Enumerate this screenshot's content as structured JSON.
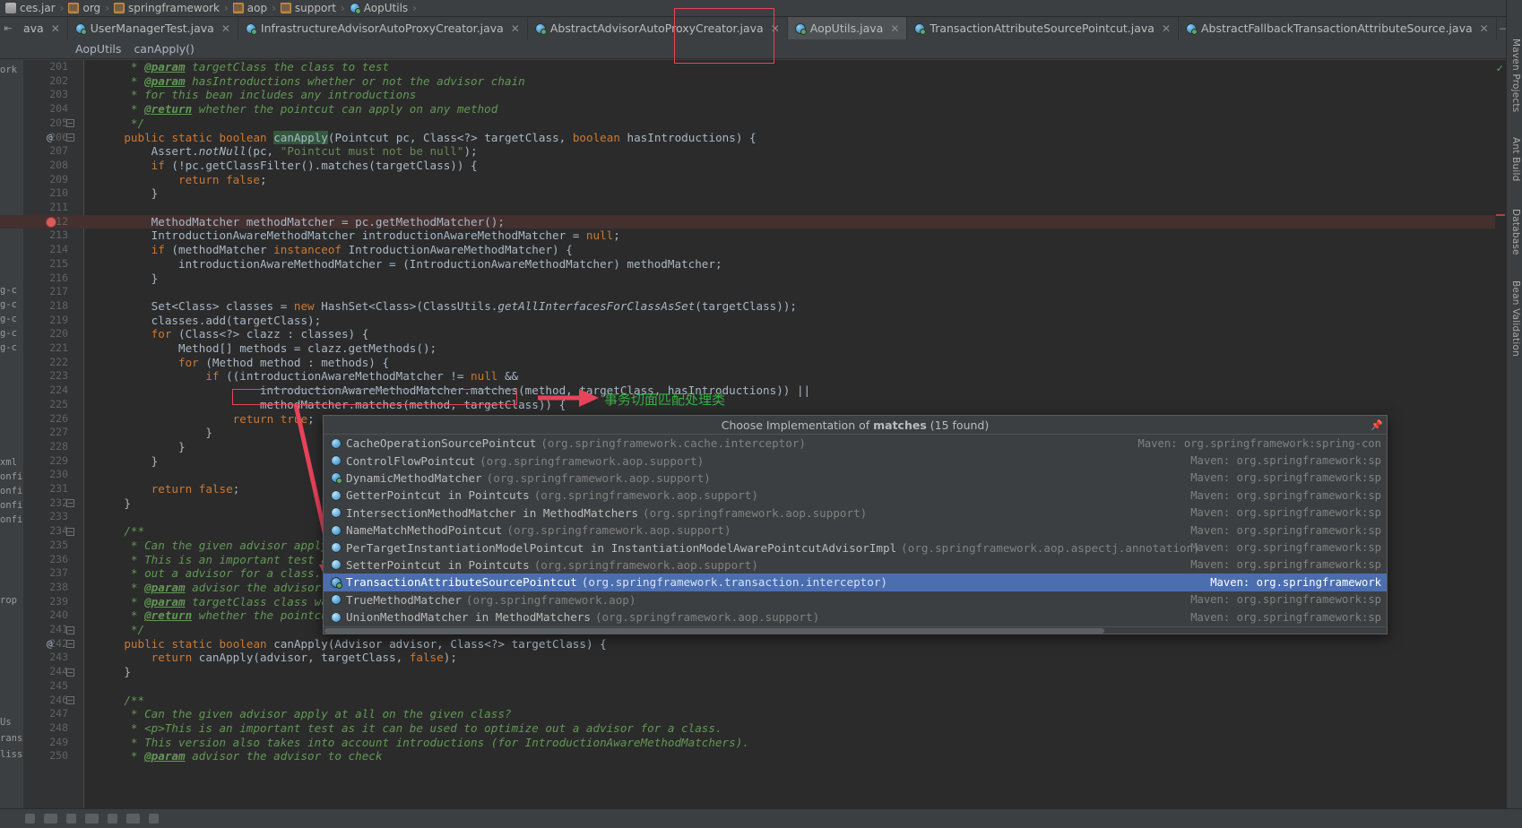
{
  "breadcrumb": [
    {
      "label": "ces.jar",
      "icon": "jar-icon"
    },
    {
      "label": "org",
      "icon": "folder-icon"
    },
    {
      "label": "springframework",
      "icon": "folder-icon"
    },
    {
      "label": "aop",
      "icon": "folder-icon"
    },
    {
      "label": "support",
      "icon": "folder-icon"
    },
    {
      "label": "AopUtils",
      "icon": "class-icon"
    }
  ],
  "tabs": [
    {
      "label": "ava",
      "icon": "class-icon",
      "active": false,
      "truncated": true
    },
    {
      "label": "UserManagerTest.java",
      "icon": "test-class-icon",
      "active": false
    },
    {
      "label": "InfrastructureAdvisorAutoProxyCreator.java",
      "icon": "class-icon",
      "active": false
    },
    {
      "label": "AbstractAdvisorAutoProxyCreator.java",
      "icon": "abstract-class-icon",
      "active": false
    },
    {
      "label": "AopUtils.java",
      "icon": "class-icon",
      "active": true
    },
    {
      "label": "TransactionAttributeSourcePointcut.java",
      "icon": "class-icon",
      "active": false
    },
    {
      "label": "AbstractFallbackTransactionAttributeSource.java",
      "icon": "abstract-class-icon",
      "active": false
    }
  ],
  "location_bar": {
    "class_name": "AopUtils",
    "method_name": "canApply()"
  },
  "annotation": {
    "chinese_note": "事务切面匹配处理类",
    "note_color": "#35b045",
    "box_color": "#e8435a",
    "boxed_code": "methodMatcher.matches(method, targetClass)"
  },
  "editor": {
    "first_line": 201,
    "breakpoint_line": 212,
    "lines": [
      {
        "n": 201,
        "text": "     * @param targetClass the class to test",
        "type": "comment",
        "clipped": true
      },
      {
        "n": 202,
        "text": "     * @param hasIntroductions whether or not the advisor chain",
        "type": "comment"
      },
      {
        "n": 203,
        "text": "     * for this bean includes any introductions",
        "type": "comment"
      },
      {
        "n": 204,
        "text": "     * @return whether the pointcut can apply on any method",
        "type": "comment"
      },
      {
        "n": 205,
        "text": "     */",
        "type": "comment"
      },
      {
        "n": 206,
        "text": "    public static boolean canApply(Pointcut pc, Class<?> targetClass, boolean hasIntroductions) {",
        "type": "code"
      },
      {
        "n": 207,
        "text": "        Assert.notNull(pc, \"Pointcut must not be null\");",
        "type": "code"
      },
      {
        "n": 208,
        "text": "        if (!pc.getClassFilter().matches(targetClass)) {",
        "type": "code"
      },
      {
        "n": 209,
        "text": "            return false;",
        "type": "code"
      },
      {
        "n": 210,
        "text": "        }",
        "type": "code"
      },
      {
        "n": 211,
        "text": "",
        "type": "code"
      },
      {
        "n": 212,
        "text": "        MethodMatcher methodMatcher = pc.getMethodMatcher();",
        "type": "code"
      },
      {
        "n": 213,
        "text": "        IntroductionAwareMethodMatcher introductionAwareMethodMatcher = null;",
        "type": "code"
      },
      {
        "n": 214,
        "text": "        if (methodMatcher instanceof IntroductionAwareMethodMatcher) {",
        "type": "code"
      },
      {
        "n": 215,
        "text": "            introductionAwareMethodMatcher = (IntroductionAwareMethodMatcher) methodMatcher;",
        "type": "code"
      },
      {
        "n": 216,
        "text": "        }",
        "type": "code"
      },
      {
        "n": 217,
        "text": "",
        "type": "code"
      },
      {
        "n": 218,
        "text": "        Set<Class> classes = new HashSet<Class>(ClassUtils.getAllInterfacesForClassAsSet(targetClass));",
        "type": "code"
      },
      {
        "n": 219,
        "text": "        classes.add(targetClass);",
        "type": "code"
      },
      {
        "n": 220,
        "text": "        for (Class<?> clazz : classes) {",
        "type": "code"
      },
      {
        "n": 221,
        "text": "            Method[] methods = clazz.getMethods();",
        "type": "code"
      },
      {
        "n": 222,
        "text": "            for (Method method : methods) {",
        "type": "code"
      },
      {
        "n": 223,
        "text": "                if ((introductionAwareMethodMatcher != null &&",
        "type": "code"
      },
      {
        "n": 224,
        "text": "                        introductionAwareMethodMatcher.matches(method, targetClass, hasIntroductions)) ||",
        "type": "code"
      },
      {
        "n": 225,
        "text": "                        methodMatcher.matches(method, targetClass)) {",
        "type": "code"
      },
      {
        "n": 226,
        "text": "                    return true;",
        "type": "code"
      },
      {
        "n": 227,
        "text": "                }",
        "type": "code"
      },
      {
        "n": 228,
        "text": "            }",
        "type": "code"
      },
      {
        "n": 229,
        "text": "        }",
        "type": "code"
      },
      {
        "n": 230,
        "text": "",
        "type": "code"
      },
      {
        "n": 231,
        "text": "        return false;",
        "type": "code"
      },
      {
        "n": 232,
        "text": "    }",
        "type": "code"
      },
      {
        "n": 233,
        "text": "",
        "type": "code"
      },
      {
        "n": 234,
        "text": "    /**",
        "type": "comment"
      },
      {
        "n": 235,
        "text": "     * Can the given advisor apply at all on the given class?",
        "type": "comment"
      },
      {
        "n": 236,
        "text": "     * This is an important test as it can be used to optimize",
        "type": "comment"
      },
      {
        "n": 237,
        "text": "     * out a advisor for a class.",
        "type": "comment"
      },
      {
        "n": 238,
        "text": "     * @param advisor the advisor to check",
        "type": "comment"
      },
      {
        "n": 239,
        "text": "     * @param targetClass class we're testing",
        "type": "comment"
      },
      {
        "n": 240,
        "text": "     * @return whether the pointcut can apply on any method",
        "type": "comment"
      },
      {
        "n": 241,
        "text": "     */",
        "type": "comment"
      },
      {
        "n": 242,
        "text": "    public static boolean canApply(Advisor advisor, Class<?> targetClass) {",
        "type": "code"
      },
      {
        "n": 243,
        "text": "        return canApply(advisor, targetClass, false);",
        "type": "code"
      },
      {
        "n": 244,
        "text": "    }",
        "type": "code"
      },
      {
        "n": 245,
        "text": "",
        "type": "code"
      },
      {
        "n": 246,
        "text": "    /**",
        "type": "comment"
      },
      {
        "n": 247,
        "text": "     * Can the given advisor apply at all on the given class?",
        "type": "comment"
      },
      {
        "n": 248,
        "text": "     * <p>This is an important test as it can be used to optimize out a advisor for a class.",
        "type": "comment"
      },
      {
        "n": 249,
        "text": "     * This version also takes into account introductions (for IntroductionAwareMethodMatchers).",
        "type": "comment"
      },
      {
        "n": 250,
        "text": "     * @param advisor the advisor to check",
        "type": "comment"
      }
    ]
  },
  "popup": {
    "title_prefix": "Choose Implementation of ",
    "title_method": "matches",
    "title_suffix": " (15 found)",
    "pin_icon": "pin-icon",
    "items": [
      {
        "name": "CacheOperationSourcePointcut",
        "pkg": "(org.springframework.cache.interceptor)",
        "maven": "Maven: org.springframework:spring-con",
        "selected": false,
        "icon": "class-icon"
      },
      {
        "name": "ControlFlowPointcut",
        "pkg": "(org.springframework.aop.support)",
        "maven": "Maven: org.springframework:sp",
        "selected": false,
        "icon": "class-icon"
      },
      {
        "name": "DynamicMethodMatcher",
        "pkg": "(org.springframework.aop.support)",
        "maven": "Maven: org.springframework:sp",
        "selected": false,
        "icon": "abstract-class-icon"
      },
      {
        "name": "GetterPointcut in Pointcuts",
        "pkg": "(org.springframework.aop.support)",
        "maven": "Maven: org.springframework:sp",
        "selected": false,
        "icon": "inner-class-icon"
      },
      {
        "name": "IntersectionMethodMatcher in MethodMatchers",
        "pkg": "(org.springframework.aop.support)",
        "maven": "Maven: org.springframework:sp",
        "selected": false,
        "icon": "inner-class-icon"
      },
      {
        "name": "NameMatchMethodPointcut",
        "pkg": "(org.springframework.aop.support)",
        "maven": "Maven: org.springframework:sp",
        "selected": false,
        "icon": "class-icon"
      },
      {
        "name": "PerTargetInstantiationModelPointcut in InstantiationModelAwarePointcutAdvisorImpl",
        "pkg": "(org.springframework.aop.aspectj.annotation)",
        "maven": "Maven: org.springframework:sp",
        "selected": false,
        "icon": "inner-class-icon"
      },
      {
        "name": "SetterPointcut in Pointcuts",
        "pkg": "(org.springframework.aop.support)",
        "maven": "Maven: org.springframework:sp",
        "selected": false,
        "icon": "inner-class-icon"
      },
      {
        "name": "TransactionAttributeSourcePointcut",
        "pkg": "(org.springframework.transaction.interceptor)",
        "maven": "Maven: org.springframework",
        "selected": true,
        "icon": "abstract-class-icon"
      },
      {
        "name": "TrueMethodMatcher",
        "pkg": "(org.springframework.aop)",
        "maven": "Maven: org.springframework:sp",
        "selected": false,
        "icon": "class-icon"
      },
      {
        "name": "UnionMethodMatcher in MethodMatchers",
        "pkg": "(org.springframework.aop.support)",
        "maven": "Maven: org.springframework:sp",
        "selected": false,
        "icon": "inner-class-icon"
      }
    ]
  },
  "right_tool_strip": [
    {
      "label": "Maven Projects"
    },
    {
      "label": "Ant Build"
    },
    {
      "label": "Database"
    },
    {
      "label": "Bean Validation"
    }
  ],
  "left_tool_strip": [
    {
      "label": "ork"
    },
    {
      "label": "g-c"
    },
    {
      "label": "g-c"
    },
    {
      "label": "g-c"
    },
    {
      "label": "g-c"
    },
    {
      "label": "g-c"
    },
    {
      "label": "xml"
    },
    {
      "label": "onfi"
    },
    {
      "label": "onfi"
    },
    {
      "label": "onfi"
    },
    {
      "label": "onfi"
    },
    {
      "label": "rop"
    },
    {
      "label": "Us"
    },
    {
      "label": "rans"
    },
    {
      "label": "liss"
    }
  ],
  "colors": {
    "background": "#2b2b2b",
    "chrome": "#3c3f41",
    "gutter": "#313335",
    "accent_selection": "#4b6eaf",
    "keyword": "#cc7832",
    "string": "#6a8759",
    "comment": "#629755",
    "text": "#a9b7c6",
    "breakpoint": "#db5c5c",
    "annotation_red": "#e8435a",
    "annotation_green": "#35b045"
  }
}
